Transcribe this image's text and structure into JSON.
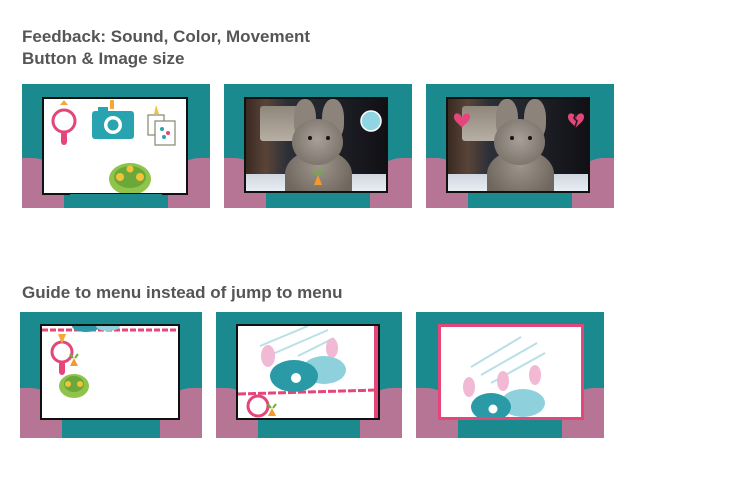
{
  "headings": {
    "feedback_line1": "Feedback: Sound, Color, Movement",
    "feedback_line2": "Button & Image size",
    "guide_word": "Guide",
    "guide_rest": "to menu instead of jump to menu"
  },
  "colors": {
    "teal": "#1b8a8f",
    "pink": "#b67595",
    "screen_border": "#111111",
    "heading_text": "#555555",
    "accent_pink": "#e4467a",
    "turtle_green": "#8fc34a",
    "turtle_yellow": "#f3c23a",
    "camera_teal": "#2aa3b1",
    "bunny_teal": "#2a9aa6",
    "bunny_lightblue": "#8ed1dd",
    "bunny_pink": "#f1b9d3"
  },
  "thumbnails_row1": [
    {
      "name": "menu-icons-screen",
      "icons": [
        "mirror-icon",
        "camera-icon",
        "photos-icon",
        "turtle-icon"
      ]
    },
    {
      "name": "photo-bunny-screen",
      "icons": [
        "bubble-button-icon",
        "carrot-icon"
      ]
    },
    {
      "name": "photo-bunny-hearts-screen",
      "icons": [
        "heart-icon",
        "broken-heart-icon"
      ]
    }
  ],
  "thumbnails_row2": [
    {
      "name": "guide-step-1-screen",
      "icons": [
        "mirror-icon",
        "turtle-icon",
        "carrot-icon"
      ]
    },
    {
      "name": "guide-step-2-screen",
      "icons": [
        "bunny-icon",
        "mirror-icon",
        "carrot-icon"
      ]
    },
    {
      "name": "guide-step-3-screen",
      "icons": [
        "bunny-icon"
      ]
    }
  ]
}
